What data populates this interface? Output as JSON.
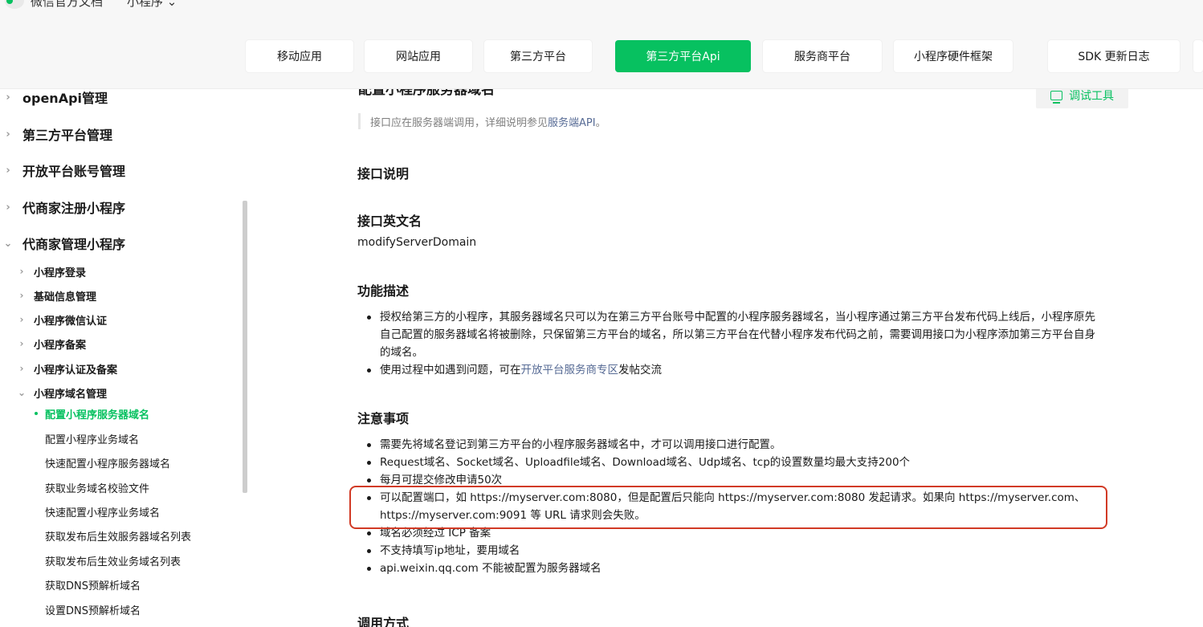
{
  "header": {
    "brand": "微信官方文档",
    "section": "小程序",
    "tabs": [
      {
        "label": "移动应用",
        "active": false
      },
      {
        "label": "网站应用",
        "active": false
      },
      {
        "label": "第三方平台",
        "active": false
      },
      {
        "label": "第三方平台Api",
        "active": true
      },
      {
        "label": "服务商平台",
        "active": false
      },
      {
        "label": "小程序硬件框架",
        "active": false
      },
      {
        "label": "SDK 更新日志",
        "active": false
      }
    ]
  },
  "sidebar": {
    "groups": [
      {
        "label": "openApi管理",
        "expanded": false
      },
      {
        "label": "第三方平台管理",
        "expanded": false
      },
      {
        "label": "开放平台账号管理",
        "expanded": false
      },
      {
        "label": "代商家注册小程序",
        "expanded": false
      },
      {
        "label": "代商家管理小程序",
        "expanded": true
      }
    ],
    "subgroups": [
      {
        "label": "小程序登录"
      },
      {
        "label": "基础信息管理"
      },
      {
        "label": "小程序微信认证"
      },
      {
        "label": "小程序备案"
      },
      {
        "label": "小程序认证及备案"
      },
      {
        "label": "小程序域名管理"
      }
    ],
    "items": [
      {
        "label": "配置小程序服务器域名",
        "active": true
      },
      {
        "label": "配置小程序业务域名"
      },
      {
        "label": "快速配置小程序服务器域名"
      },
      {
        "label": "获取业务域名校验文件"
      },
      {
        "label": "快速配置小程序业务域名"
      },
      {
        "label": "获取发布后生效服务器域名列表"
      },
      {
        "label": "获取发布后生效业务域名列表"
      },
      {
        "label": "获取DNS预解析域名"
      },
      {
        "label": "设置DNS预解析域名"
      }
    ]
  },
  "content": {
    "page_title": "配置小程序服务器域名",
    "debug_button": "调试工具",
    "notice_text": "接口应在服务器端调用，详细说明参见",
    "notice_link": "服务端API",
    "notice_end": "。",
    "h_interface": "接口说明",
    "h_english_name": "接口英文名",
    "english_name": "modifyServerDomain",
    "h_function": "功能描述",
    "function_items": [
      {
        "lines": [
          "授权给第三方的小程序，其服务器域名只可以为在第三方平台账号中配置的小程序服务器域名，当小程序通过第三方平台发布代码上线后，小程序原先",
          "自己配置的服务器域名将被删除，只保留第三方平台的域名，所以第三方平台在代替小程序发布代码之前，需要调用接口为小程序添加第三方平台自身",
          "的域名。"
        ]
      },
      {
        "pre": "使用过程中如遇到问题，可在",
        "link": "开放平台服务商专区",
        "post": "发帖交流"
      }
    ],
    "h_notes": "注意事项",
    "notes": [
      {
        "text": "需要先将域名登记到第三方平台的小程序服务器域名中，才可以调用接口进行配置。"
      },
      {
        "text": "Request域名、Socket域名、Uploadfile域名、Download域名、Udp域名、tcp的设置数量均最大支持200个"
      },
      {
        "text": "每月可提交修改申请50次"
      },
      {
        "lines": [
          "可以配置端口，如 https://myserver.com:8080，但是配置后只能向 https://myserver.com:8080 发起请求。如果向 https://myserver.com、",
          "https://myserver.com:9091 等 URL 请求则会失败。"
        ]
      },
      {
        "text": "域名必须经过 ICP 备案"
      },
      {
        "text": "不支持填写ip地址，要用域名"
      },
      {
        "text": "api.weixin.qq.com 不能被配置为服务器域名"
      }
    ],
    "h_call": "调用方式"
  },
  "colors": {
    "accent": "#07c160",
    "link": "#576b95",
    "highlight": "#d13a25"
  }
}
